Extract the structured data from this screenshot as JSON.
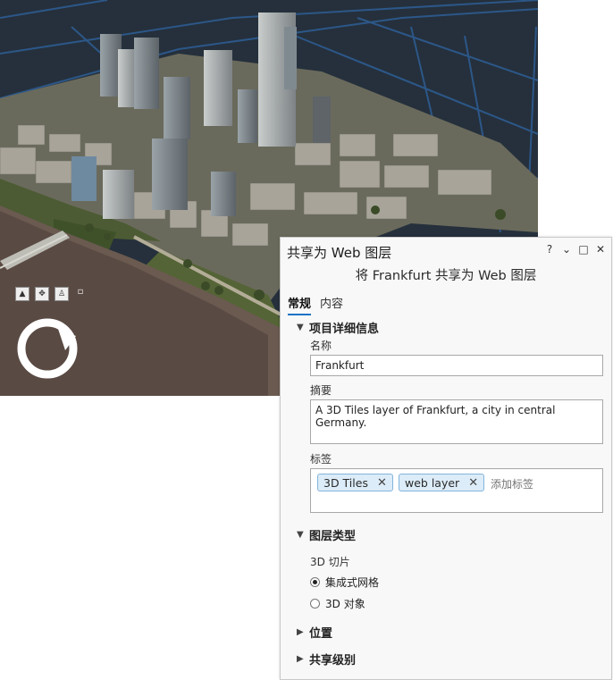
{
  "scene": {
    "nav_icons": [
      "up-arrow-icon",
      "pan-icon",
      "walk-icon",
      "small-grid-icon"
    ],
    "compass_icon": "navigator-compass-icon"
  },
  "pane": {
    "title": "共享为 Web 图层",
    "controls": {
      "help": "?",
      "dropdown": "⌄",
      "maximize": "□",
      "close": "✕"
    },
    "subtitle": "将 Frankfurt 共享为 Web 图层",
    "tabs": [
      {
        "label": "常规",
        "active": true
      },
      {
        "label": "内容",
        "active": false
      }
    ],
    "details": {
      "heading": "项目详细信息",
      "name_label": "名称",
      "name_value": "Frankfurt",
      "summary_label": "摘要",
      "summary_value": "A 3D Tiles layer of Frankfurt, a city in central Germany.",
      "tags_label": "标签",
      "tags": [
        "3D Tiles",
        "web layer"
      ],
      "tag_placeholder": "添加标签"
    },
    "layer_type": {
      "heading": "图层类型",
      "sub_label": "3D 切片",
      "options": [
        {
          "label": "集成式网格",
          "selected": true
        },
        {
          "label": "3D 对象",
          "selected": false
        }
      ]
    },
    "location_heading": "位置",
    "sharing_heading": "共享级别"
  },
  "colors": {
    "accent": "#1a73c6",
    "chip_bg": "#dcecf8",
    "chip_border": "#83b5dc"
  }
}
